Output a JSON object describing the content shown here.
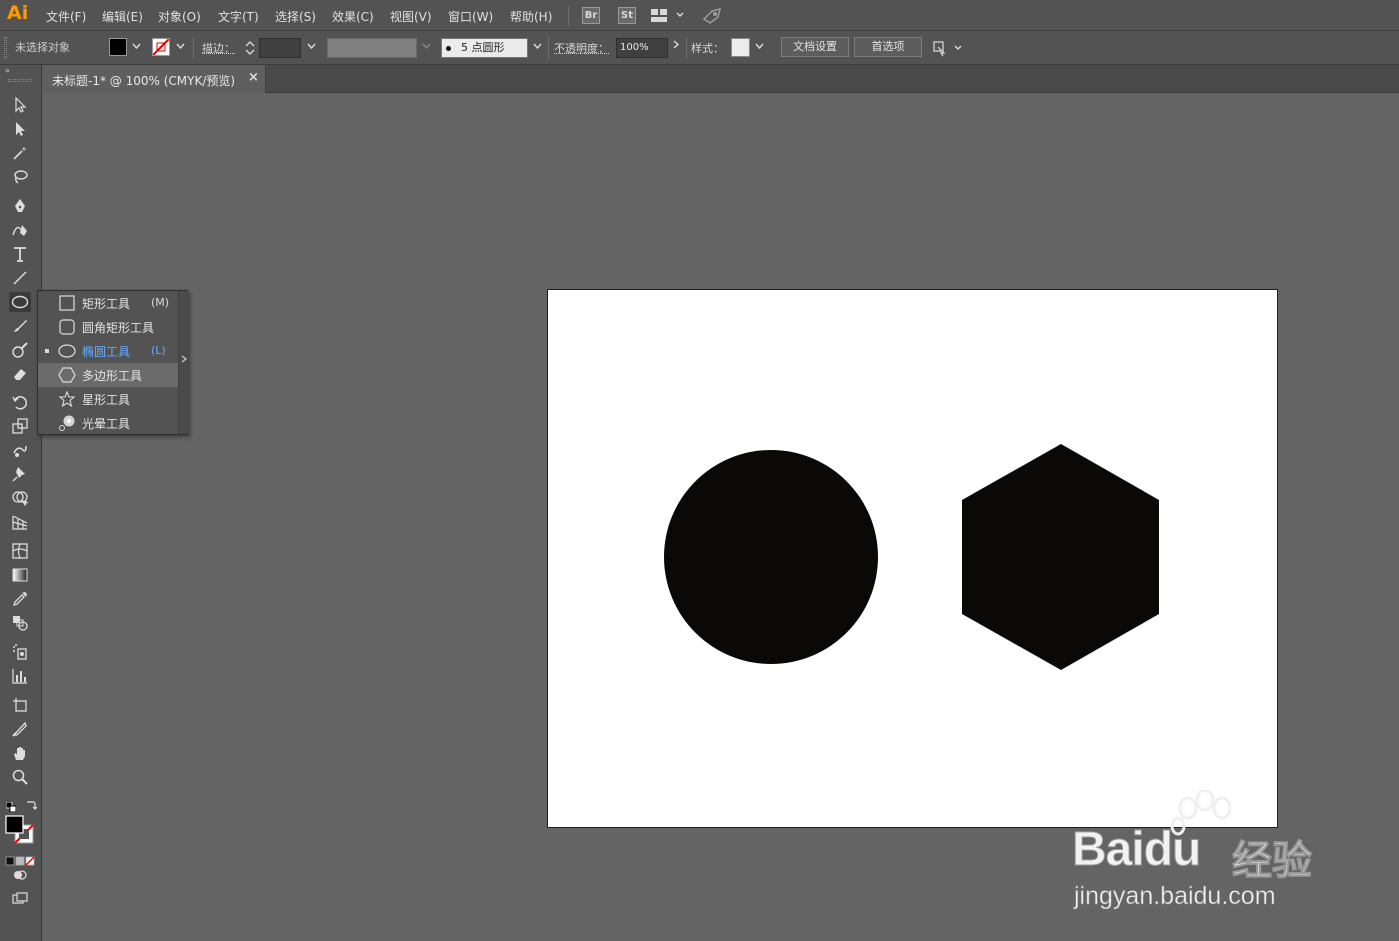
{
  "app": {
    "logo": "Ai",
    "menus": [
      "文件(F)",
      "编辑(E)",
      "对象(O)",
      "文字(T)",
      "选择(S)",
      "效果(C)",
      "视图(V)",
      "窗口(W)",
      "帮助(H)"
    ],
    "bridge_label": "Br",
    "stock_label": "St"
  },
  "control_bar": {
    "selection_status": "未选择对象",
    "stroke_label": "描边：",
    "brush_size": "5",
    "brush_profile": "点圆形",
    "opacity_label": "不透明度：",
    "opacity_value": "100%",
    "style_label": "样式：",
    "doc_setup_button": "文档设置",
    "preferences_button": "首选项"
  },
  "document": {
    "tab_title": "未标题-1* @ 100% (CMYK/预览)",
    "close_glyph": "×"
  },
  "flyout": {
    "items": [
      {
        "label": "矩形工具",
        "shortcut": "(M)",
        "icon": "rectangle-icon",
        "selected": false
      },
      {
        "label": "圆角矩形工具",
        "shortcut": "",
        "icon": "rounded-rectangle-icon",
        "selected": false
      },
      {
        "label": "椭圆工具",
        "shortcut": "(L)",
        "icon": "ellipse-icon",
        "selected": true
      },
      {
        "label": "多边形工具",
        "shortcut": "",
        "icon": "polygon-icon",
        "selected": false,
        "hover": true
      },
      {
        "label": "星形工具",
        "shortcut": "",
        "icon": "star-icon",
        "selected": false
      },
      {
        "label": "光晕工具",
        "shortcut": "",
        "icon": "flare-icon",
        "selected": false
      }
    ]
  },
  "canvas": {
    "shapes": [
      {
        "type": "circle",
        "fill": "#0b0908"
      },
      {
        "type": "hexagon",
        "fill": "#0b0908"
      }
    ]
  },
  "watermark": {
    "brand": "Baidu",
    "brand_suffix": "经验",
    "url": "jingyan.baidu.com"
  },
  "colors": {
    "logo": "#ff9a00",
    "selected_tool_text": "#6aaaff",
    "panel_bg": "#535353",
    "canvas_bg": "#646464"
  }
}
